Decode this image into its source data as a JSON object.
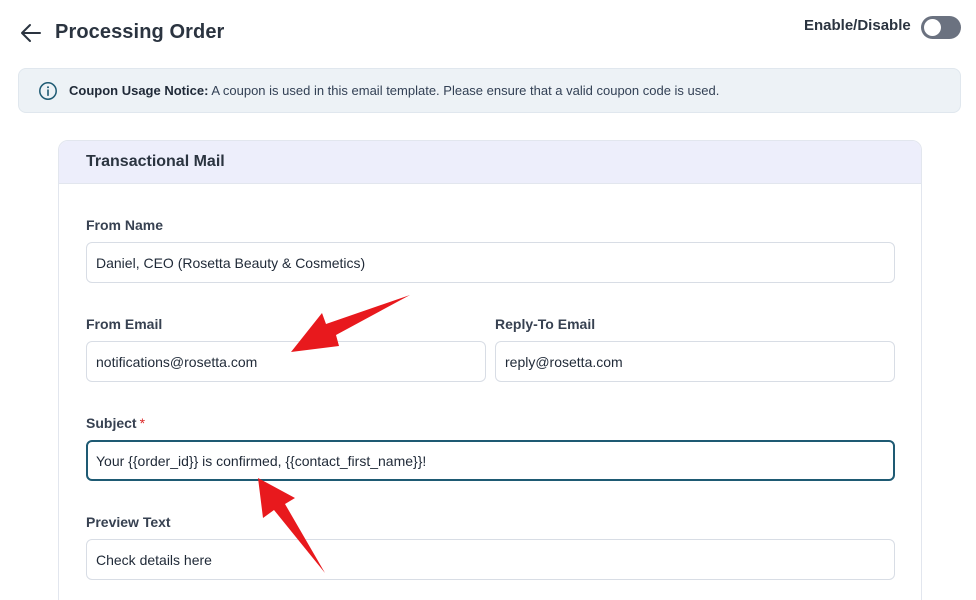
{
  "header": {
    "title": "Processing Order",
    "toggle_label": "Enable/Disable",
    "toggle_on": false
  },
  "notice": {
    "title": "Coupon Usage Notice:",
    "message": "A coupon is used in this email template. Please ensure that a valid coupon code is used."
  },
  "card": {
    "title": "Transactional Mail",
    "fields": {
      "from_name": {
        "label": "From Name",
        "value": "Daniel, CEO (Rosetta Beauty & Cosmetics)"
      },
      "from_email": {
        "label": "From Email",
        "value": "notifications@rosetta.com"
      },
      "reply_to": {
        "label": "Reply-To Email",
        "value": "reply@rosetta.com"
      },
      "subject": {
        "label": "Subject",
        "required_mark": "*",
        "value": "Your {{order_id}} is confirmed, {{contact_first_name}}!"
      },
      "preview_text": {
        "label": "Preview Text",
        "value": "Check details here"
      }
    }
  },
  "colors": {
    "accent": "#1e5a73",
    "annotation": "#e8191d",
    "header_bg": "#edeefb",
    "notice_bg": "#edf2f6"
  },
  "icons": {
    "back": "arrow-left-icon",
    "info": "info-icon"
  }
}
